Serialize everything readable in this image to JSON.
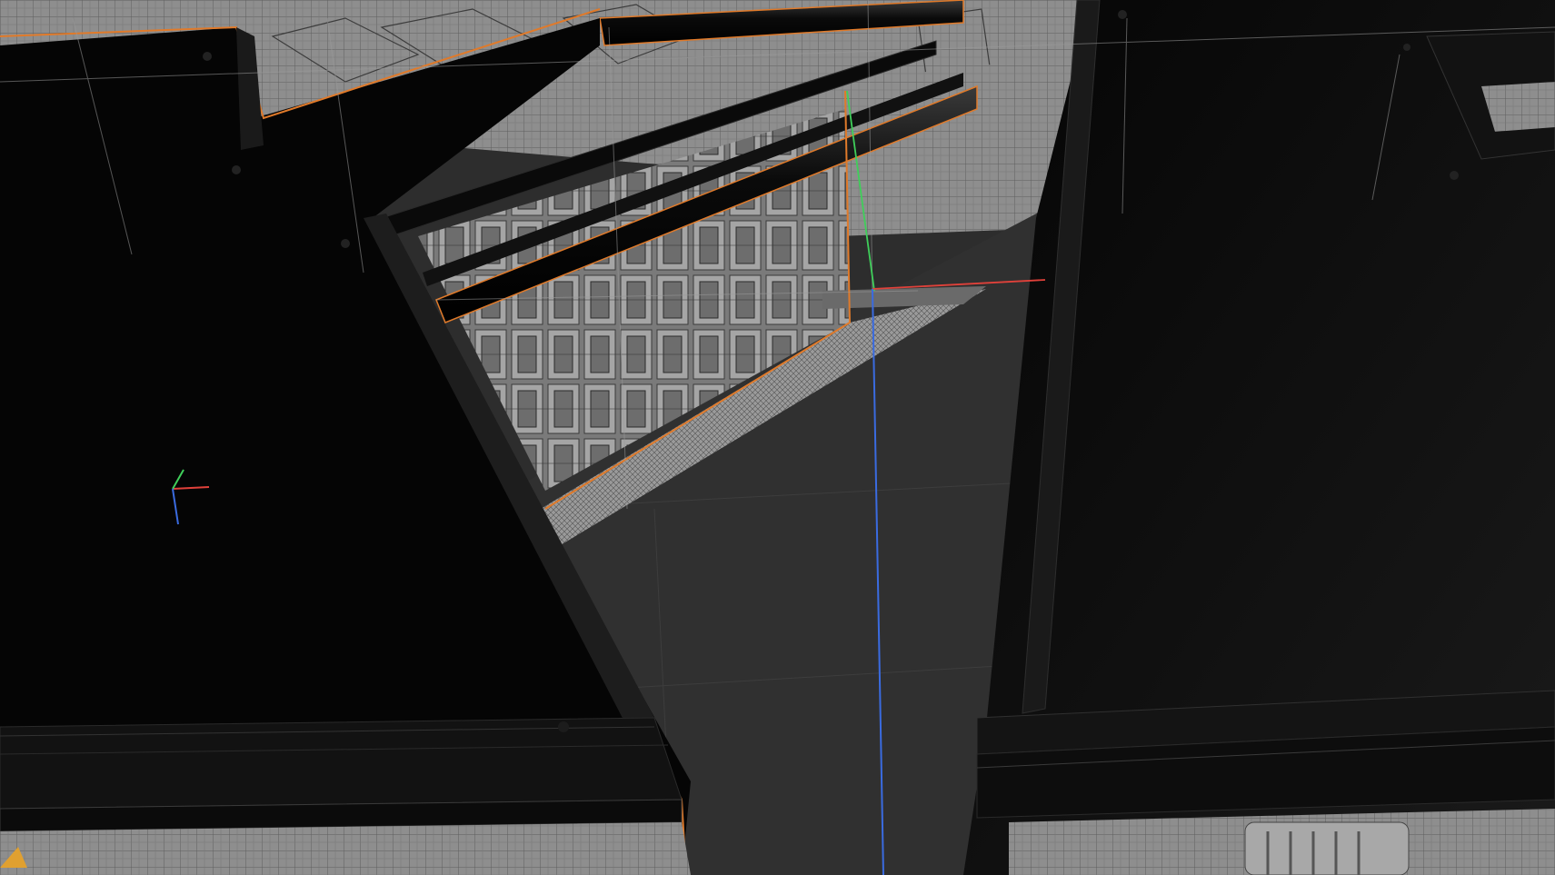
{
  "viewport": {
    "background": "#2b2b2b",
    "colors": {
      "selection_outline": "#e07a2a",
      "axis_x": "#e0413a",
      "axis_y": "#3fcf5a",
      "axis_z": "#3a6be0",
      "wire_light": "#9a9a9a",
      "panel_black": "#050505"
    },
    "gizmo": {
      "axes": [
        "x",
        "y",
        "z"
      ]
    }
  }
}
